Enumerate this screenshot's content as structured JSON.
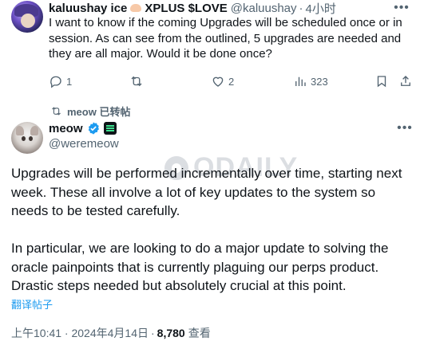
{
  "reply_tweet": {
    "display_name": "kaluushay ice",
    "display_name_suffix": "XPLUS $LOVE",
    "handle": "@kaluushay",
    "separator": "·",
    "time": "4小时",
    "text": "I want to know if the coming Upgrades will be scheduled once or in session. As can see from the outlined, 5 upgrades are needed and they are all major. Would it be done once?",
    "actions": {
      "reply_count": "1",
      "repost_count": "",
      "like_count": "2",
      "view_count": "323"
    }
  },
  "repost_label": "meow 已转帖",
  "main_tweet": {
    "display_name": "meow",
    "handle": "@weremeow",
    "paragraph_1": "Upgrades will be performed incrementally over time, starting next week. These all involve a lot of key updates to the system so needs to be tested carefully.",
    "paragraph_2": "In particular, we are looking to do a major update to solving the oracle painpoints that is currently plaguing our perps product. Drastic steps needed but absolutely crucial at this point.",
    "translate_label": "翻译帖子",
    "timestamp": "上午10:41 · 2024年4月14日",
    "separator": "·",
    "views": "8,780",
    "views_label": "查看"
  },
  "watermark_text": "ODAILY",
  "icons": {
    "reply": "comment-icon",
    "repost": "repost-icon",
    "like": "heart-icon",
    "views": "analytics-icon",
    "bookmark": "bookmark-icon",
    "share": "share-icon",
    "more": "more-icon",
    "verified": "verified-icon"
  },
  "colors": {
    "text": "#0f1419",
    "secondary": "#536471",
    "link": "#1d9bf0"
  }
}
